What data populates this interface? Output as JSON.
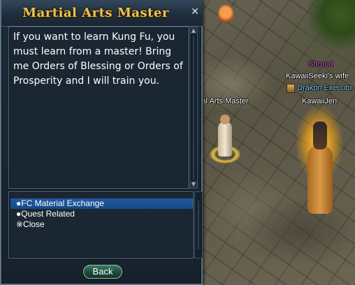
{
  "dialog": {
    "title": "Martial Arts Master",
    "close_glyph": "✕",
    "text": "If you want to learn Kung Fu, you must learn from a master! Bring me Orders of Blessing or Orders of Prosperity and I will train you.",
    "options": [
      {
        "label": "●FC Material Exchange",
        "selected": true
      },
      {
        "label": "●Quest Related",
        "selected": false
      },
      {
        "label": "※Close",
        "selected": false
      }
    ],
    "back_label": "Back"
  },
  "world": {
    "labels": {
      "shroud": "Shroud",
      "wife": "KawaiiSeeki's wife",
      "guild": "Drākōn Executo",
      "npc": "Martial Arts Master",
      "player": "KawaiiJen"
    }
  },
  "colors": {
    "title": "#f2c24a",
    "selected_option": "#1f5a9e",
    "shroud_label": "#e060e0",
    "guild_label": "#7fd7ff"
  },
  "icons": [
    "close-icon",
    "scroll-up-icon",
    "scroll-down-icon",
    "guild-emblem-icon"
  ]
}
